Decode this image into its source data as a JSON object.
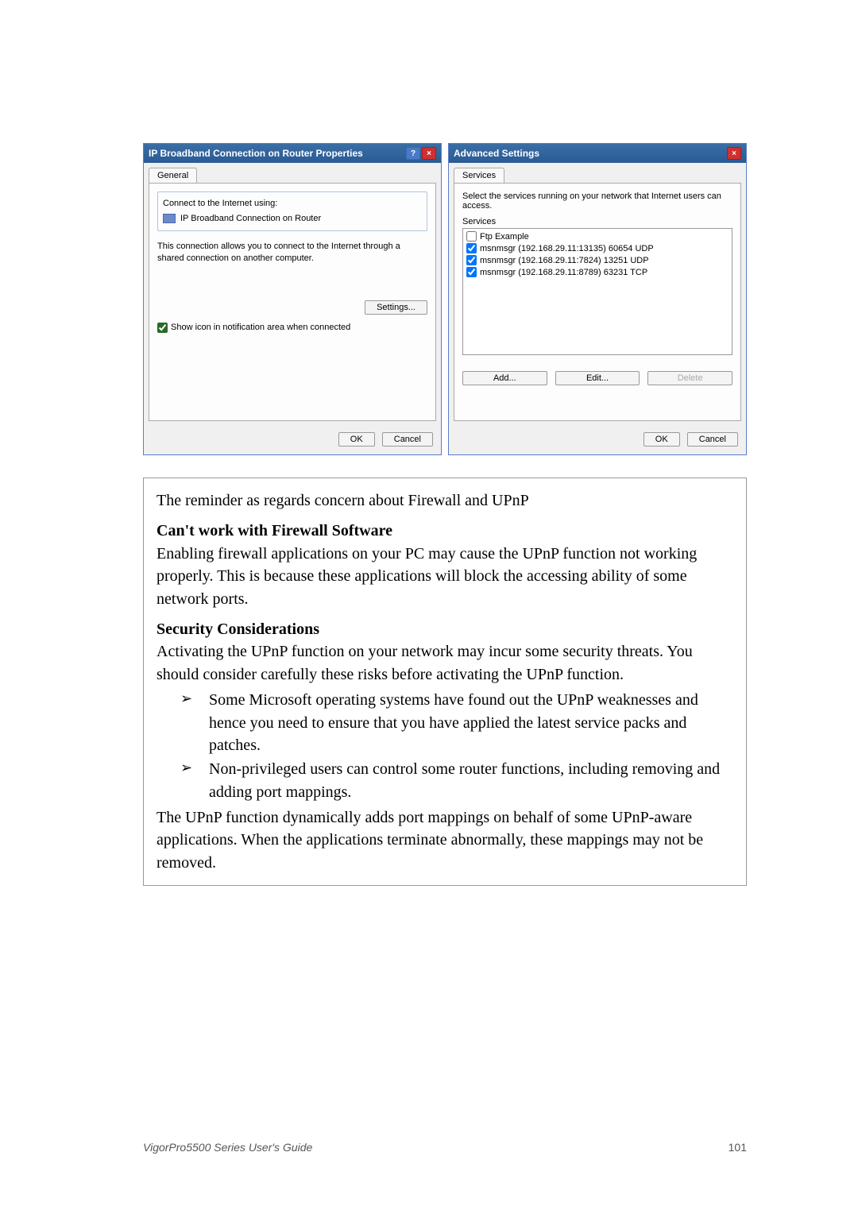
{
  "dialog1": {
    "title": "IP Broadband Connection on Router Properties",
    "tab": "General",
    "group_label": "Connect to the Internet using:",
    "conn_name": "IP Broadband Connection on Router",
    "desc": "This connection allows you to connect to the Internet through a shared connection on another computer.",
    "settings_btn": "Settings...",
    "show_icon": "Show icon in notification area when connected",
    "ok": "OK",
    "cancel": "Cancel"
  },
  "dialog2": {
    "title": "Advanced Settings",
    "tab": "Services",
    "intro": "Select the services running on your network that Internet users can access.",
    "group_label": "Services",
    "items": {
      "i0": "Ftp Example",
      "i1": "msnmsgr (192.168.29.11:13135) 60654 UDP",
      "i2": "msnmsgr (192.168.29.11:7824) 13251 UDP",
      "i3": "msnmsgr (192.168.29.11:8789) 63231 TCP"
    },
    "add": "Add...",
    "edit": "Edit...",
    "delete": "Delete",
    "ok": "OK",
    "cancel": "Cancel"
  },
  "content": {
    "reminder": "The reminder as regards concern about Firewall and UPnP",
    "h1": "Can't work with Firewall Software",
    "p1": "Enabling firewall applications on your PC may cause the UPnP function not working properly. This is because these applications will block the accessing ability of some network ports.",
    "h2": "Security Considerations",
    "p2": "Activating the UPnP function on your network may incur some security threats. You should consider carefully these risks before activating the UPnP function.",
    "b1": "Some Microsoft operating systems have found out the UPnP weaknesses and hence you need to ensure that you have applied the latest service packs and patches.",
    "b2": "Non-privileged users can control some router functions, including removing and adding port mappings.",
    "p3": "The UPnP function dynamically adds port mappings on behalf of some UPnP-aware applications. When the applications terminate abnormally, these mappings may not be removed."
  },
  "footer": {
    "left": "VigorPro5500 Series User's Guide",
    "right": "101"
  }
}
